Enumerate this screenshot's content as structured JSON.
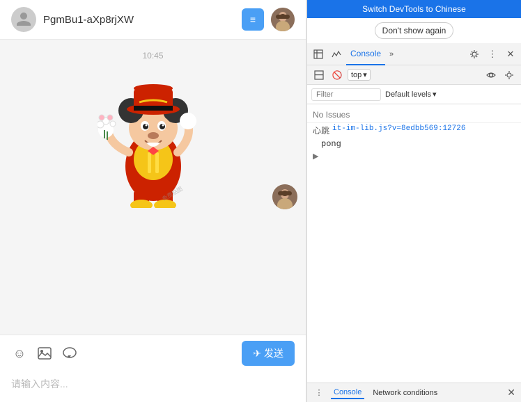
{
  "chat": {
    "username": "PgmBu1-aXp8rjXW",
    "timestamp": "10:45",
    "header_btn_label": "≡",
    "send_btn": "✈ 发送",
    "input_placeholder": "请输入内容...",
    "toolbar_icons": [
      "emoji",
      "image",
      "bubble"
    ]
  },
  "devtools": {
    "switch_banner": "Switch DevTools to Chinese",
    "dont_show": "Don't show again",
    "tabs": [
      "Elements",
      "Network",
      "Console",
      "More"
    ],
    "console_label": "Console",
    "top_label": "top",
    "filter_placeholder": "Filter",
    "default_levels": "Default levels",
    "no_issues": "No Issues",
    "log_source": "心跳",
    "log_link": "it-im-lib.js?v=8edbb569:12726",
    "log_text": "pong",
    "bottom_tabs": [
      "Console",
      "Network conditions"
    ]
  }
}
